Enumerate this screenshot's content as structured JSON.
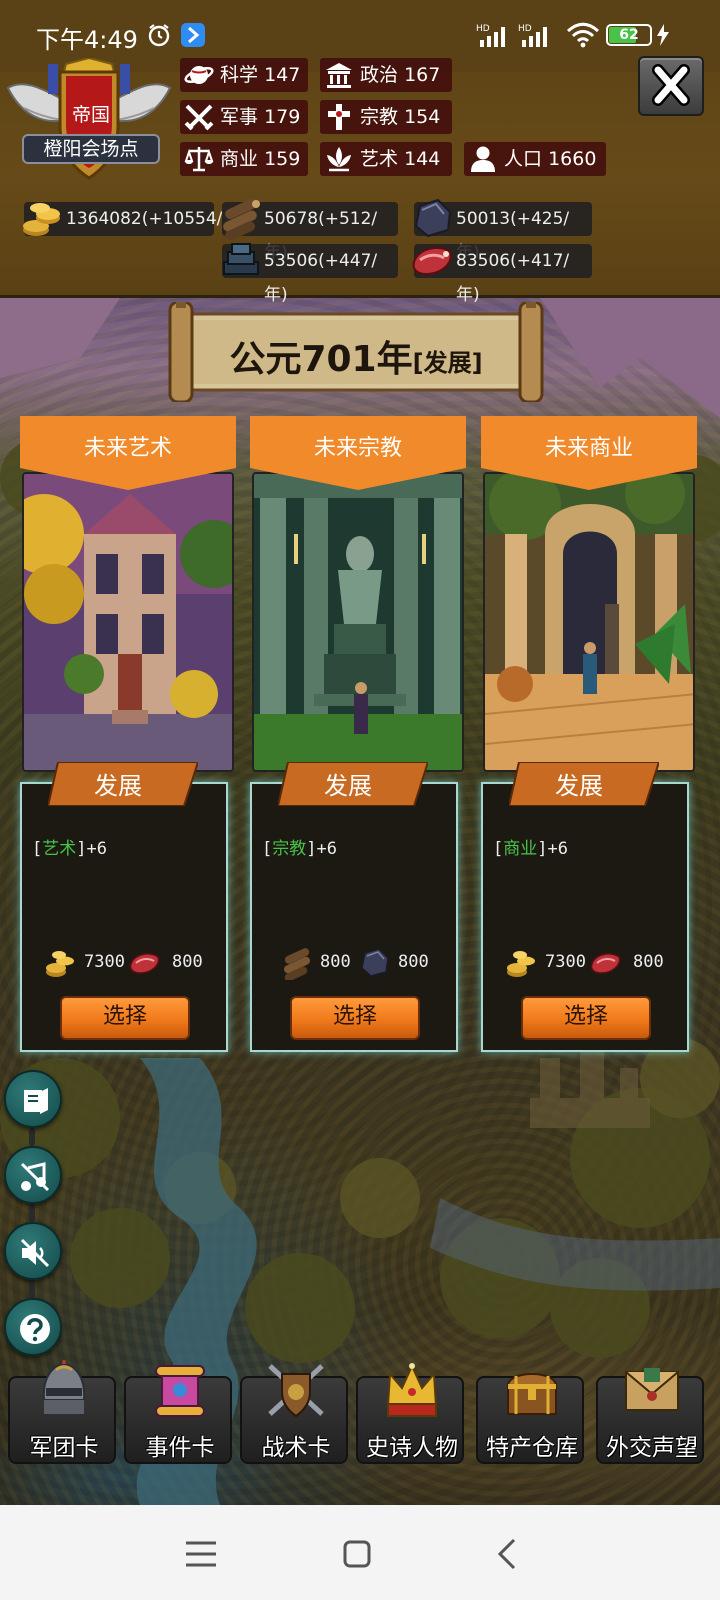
{
  "status_bar": {
    "time": "下午4:49",
    "battery": "62"
  },
  "empire": {
    "title": "帝国",
    "place": "橙阳会场点"
  },
  "stats": [
    {
      "label": "科学",
      "value": "147",
      "icon": "planet-icon"
    },
    {
      "label": "政治",
      "value": "167",
      "icon": "temple-icon"
    },
    {
      "label": "军事",
      "value": "179",
      "icon": "crossed-swords-icon"
    },
    {
      "label": "宗教",
      "value": "154",
      "icon": "cross-icon"
    },
    {
      "label": "商业",
      "value": "159",
      "icon": "scales-icon"
    },
    {
      "label": "艺术",
      "value": "144",
      "icon": "lotus-icon"
    },
    {
      "label": "人口",
      "value": "1660",
      "icon": "person-icon"
    }
  ],
  "resources": [
    {
      "text": "1364082(+10554/",
      "icon": "gold-coins-icon"
    },
    {
      "text": "50678(+512/年)",
      "icon": "wood-logs-icon"
    },
    {
      "text": "50013(+425/年)",
      "icon": "stone-icon"
    },
    {
      "text": "53506(+447/年)",
      "icon": "iron-icon"
    },
    {
      "text": "83506(+417/年)",
      "icon": "meat-icon"
    }
  ],
  "year": {
    "text": "公元701年",
    "phase": "[发展]"
  },
  "cards": [
    {
      "title": "未来艺术",
      "ribbon": "发展",
      "effect_open": "[",
      "effect_attr": "艺术",
      "effect_close": "]+6",
      "costs": [
        {
          "icon": "gold-coins-icon",
          "amount": "7300"
        },
        {
          "icon": "meat-icon",
          "amount": "800"
        }
      ],
      "button": "选择"
    },
    {
      "title": "未来宗教",
      "ribbon": "发展",
      "effect_open": "[",
      "effect_attr": "宗教",
      "effect_close": "]+6",
      "costs": [
        {
          "icon": "wood-logs-icon",
          "amount": "800"
        },
        {
          "icon": "stone-icon",
          "amount": "800"
        }
      ],
      "button": "选择"
    },
    {
      "title": "未来商业",
      "ribbon": "发展",
      "effect_open": "[",
      "effect_attr": "商业",
      "effect_close": "]+6",
      "costs": [
        {
          "icon": "gold-coins-icon",
          "amount": "7300"
        },
        {
          "icon": "meat-icon",
          "amount": "800"
        }
      ],
      "button": "选择"
    }
  ],
  "side_tools": [
    "book-icon",
    "music-off-icon",
    "sound-off-icon",
    "help-icon"
  ],
  "bottom_menu": [
    {
      "label": "军团卡",
      "icon": "helmet-icon"
    },
    {
      "label": "事件卡",
      "icon": "scroll-icon"
    },
    {
      "label": "战术卡",
      "icon": "shield-swords-icon"
    },
    {
      "label": "史诗人物",
      "icon": "crown-icon"
    },
    {
      "label": "特产仓库",
      "icon": "treasure-chest-icon"
    },
    {
      "label": "外交声望",
      "icon": "envelope-icon"
    }
  ],
  "colors": {
    "header_bg": "#5b4216",
    "orange_accent": "#f08a2a",
    "effect_green": "#49c24a",
    "panel_glow": "#a8d8d0"
  }
}
